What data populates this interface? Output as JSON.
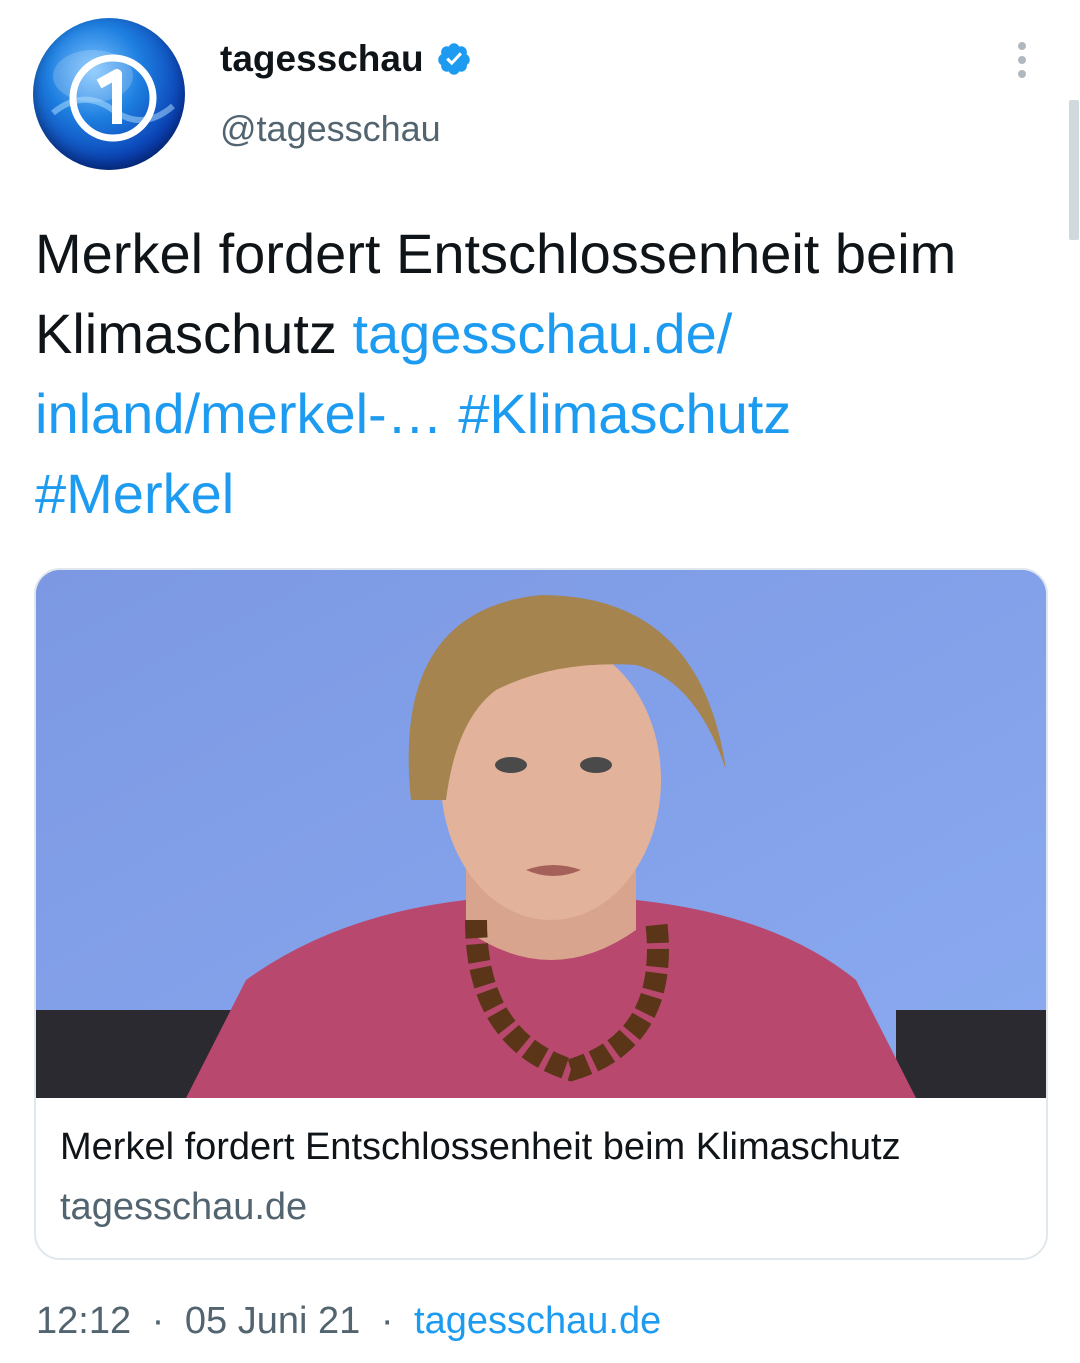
{
  "header": {
    "name": "tagesschau",
    "handle": "@tagesschau"
  },
  "tweet": {
    "text": "Merkel fordert Entschlossenheit beim Klimaschutz ",
    "link": "tagesschau.de/ inland/merkel-…",
    "hashtag1": "#Klimaschutz",
    "hashtag2": "#Merkel"
  },
  "card": {
    "title": "Merkel fordert Entschlossenheit beim Klimaschutz",
    "domain": "tagesschau.de"
  },
  "meta": {
    "time": "12:12",
    "sep1": "·",
    "date": "05 Juni 21",
    "sep2": "·",
    "source": "tagesschau.de"
  },
  "colors": {
    "link": "#1d9bf0",
    "secondary": "#536471",
    "verified": "#1d9bf0",
    "card_background": "#7e9de0"
  }
}
